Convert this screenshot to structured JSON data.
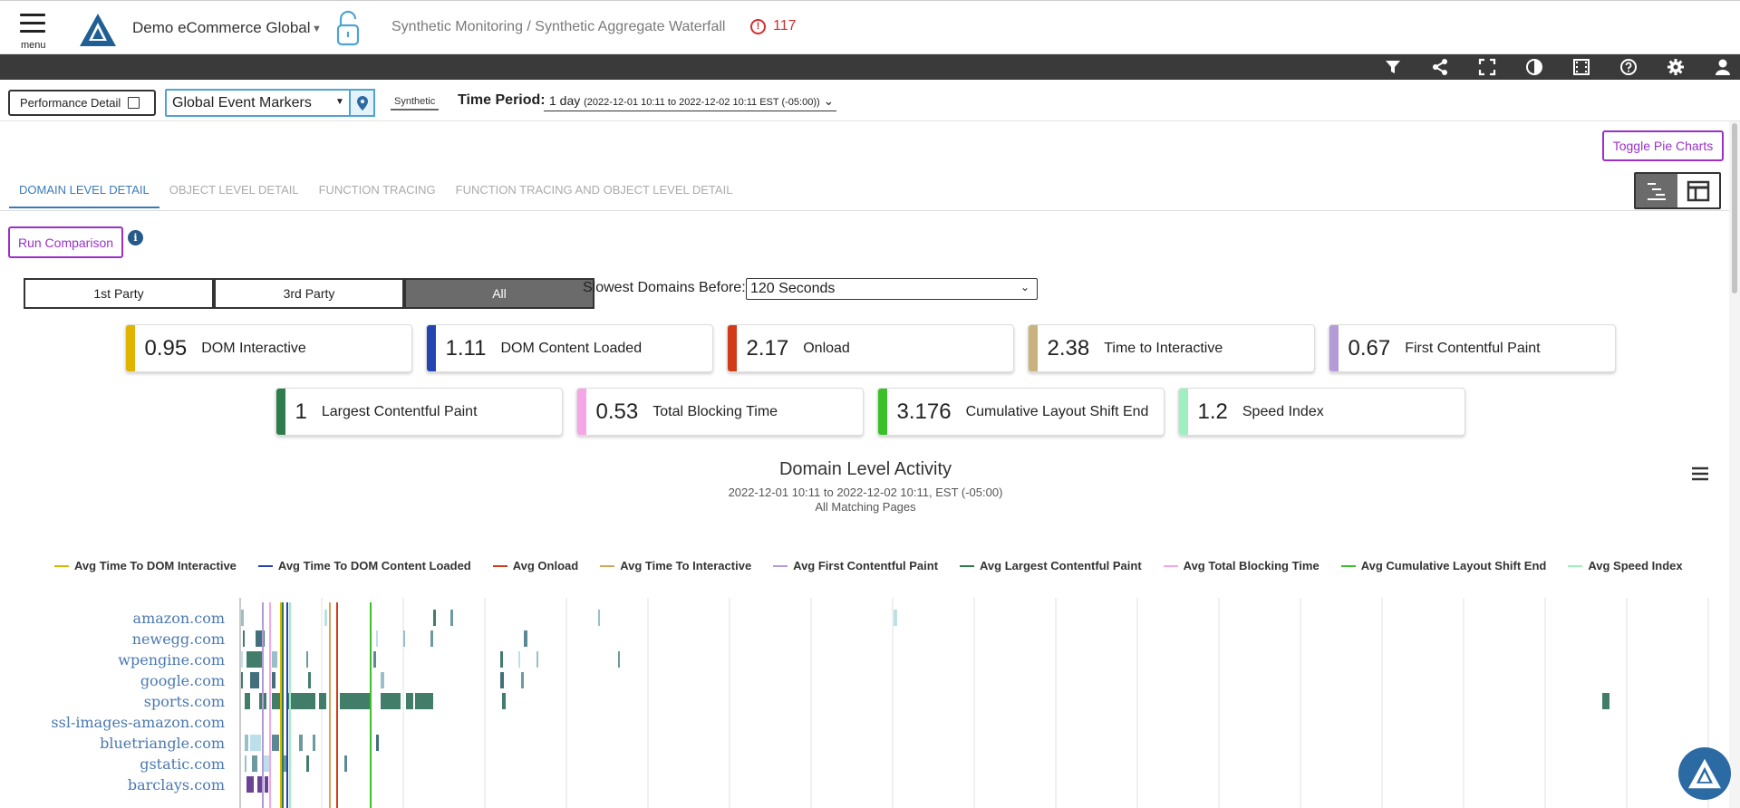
{
  "header": {
    "menu_label": "menu",
    "app_name": "Demo eCommerce Global",
    "breadcrumb": "Synthetic Monitoring / Synthetic Aggregate Waterfall",
    "alert_count": "117",
    "alert_icon_glyph": "!",
    "dropdown_caret": "▼"
  },
  "toolbar": {
    "icons": [
      "filter-icon",
      "share-icon",
      "fullscreen-icon",
      "contrast-icon",
      "film-icon",
      "help-icon",
      "gear-icon",
      "user-icon"
    ]
  },
  "filters": {
    "performance_detail": "Performance Detail",
    "event_markers": "Global Event Markers",
    "synthetic_tag": "Synthetic",
    "time_period_label": "Time Period:",
    "time_period_value": "1 day",
    "time_period_range": "(2022-12-01 10:11 to 2022-12-02 10:11 EST (-05:00))",
    "time_caret": "⌄"
  },
  "toggle_pie_charts": "Toggle Pie Charts",
  "tabs": [
    {
      "label": "DOMAIN LEVEL DETAIL",
      "active": true
    },
    {
      "label": "OBJECT LEVEL DETAIL",
      "active": false
    },
    {
      "label": "FUNCTION TRACING",
      "active": false
    },
    {
      "label": "FUNCTION TRACING AND OBJECT LEVEL DETAIL",
      "active": false
    }
  ],
  "run_comparison": "Run Comparison",
  "info_glyph": "i",
  "party_buttons": [
    {
      "label": "1st Party",
      "selected": false
    },
    {
      "label": "3rd Party",
      "selected": false
    },
    {
      "label": "All",
      "selected": true
    }
  ],
  "slowest_label": "Slowest Domains Before:",
  "slowest_value": "120 Seconds",
  "select_caret": "⌄",
  "metrics_row1": [
    {
      "value": "0.95",
      "label": "DOM Interactive",
      "color": "#e0b400"
    },
    {
      "value": "1.11",
      "label": "DOM Content Loaded",
      "color": "#2345b0"
    },
    {
      "value": "2.17",
      "label": "Onload",
      "color": "#d23b17"
    },
    {
      "value": "2.38",
      "label": "Time to Interactive",
      "color": "#c9b27c"
    },
    {
      "value": "0.67",
      "label": "First Contentful Paint",
      "color": "#b49ad6"
    }
  ],
  "metrics_row2": [
    {
      "value": "1",
      "label": "Largest Contentful Paint",
      "color": "#2e7d4a"
    },
    {
      "value": "0.53",
      "label": "Total Blocking Time",
      "color": "#f4a6e6"
    },
    {
      "value": "3.176",
      "label": "Cumulative Layout Shift End",
      "color": "#3cc02a"
    },
    {
      "value": "1.2",
      "label": "Speed Index",
      "color": "#9ef0c0"
    }
  ],
  "chart": {
    "title": "Domain Level Activity",
    "subtitle_range": "2022-12-01 10:11 to 2022-12-02 10:11, EST (-05:00)",
    "subtitle_pages": "All Matching Pages",
    "legend": [
      {
        "label": "Avg Time To DOM Interactive",
        "color": "#e0b400"
      },
      {
        "label": "Avg Time To DOM Content Loaded",
        "color": "#2345b0"
      },
      {
        "label": "Avg Onload",
        "color": "#d23b17"
      },
      {
        "label": "Avg Time To Interactive",
        "color": "#d9a45a"
      },
      {
        "label": "Avg First Contentful Paint",
        "color": "#b49ad6"
      },
      {
        "label": "Avg Largest Contentful Paint",
        "color": "#2e7d4a"
      },
      {
        "label": "Avg Total Blocking Time",
        "color": "#f4a6e6"
      },
      {
        "label": "Avg Cumulative Layout Shift End",
        "color": "#3cc02a"
      },
      {
        "label": "Avg Speed Index",
        "color": "#9ef0c0"
      }
    ],
    "domains": [
      "amazon.com",
      "newegg.com",
      "wpengine.com",
      "google.com",
      "sports.com",
      "ssl-images-amazon.com",
      "bluetriangle.com",
      "gstatic.com",
      "barclays.com"
    ]
  }
}
